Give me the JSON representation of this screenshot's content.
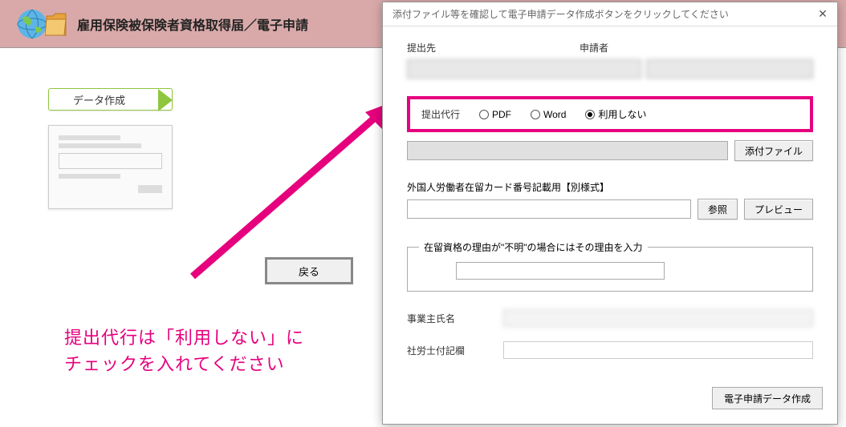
{
  "header": {
    "title": "雇用保険被保険者資格取得届／電子申請"
  },
  "leftPane": {
    "stepLabel": "データ作成",
    "backButton": "戻る"
  },
  "annotation": {
    "line1": "提出代行は「利用しない」に",
    "line2": "チェックを入れてください"
  },
  "dialog": {
    "titleBar": "添付ファイル等を確認して電子申請データ作成ボタンをクリックしてください",
    "labels": {
      "destination": "提出先",
      "applicant": "申請者",
      "submissionProxy": "提出代行",
      "pdf": "PDF",
      "word": "Word",
      "notUse": "利用しない",
      "attachButton": "添付ファイル",
      "foreignCard": "外国人労働者在留カード番号記載用【別様式】",
      "browse": "参照",
      "preview": "プレビュー",
      "reasonLegend": "在留資格の理由が\"不明\"の場合にはその理由を入力",
      "employerName": "事業主氏名",
      "sharoushiNote": "社労士付記欄",
      "createData": "電子申請データ作成"
    },
    "values": {
      "destination": "",
      "applicant": "",
      "employerName": ""
    }
  }
}
